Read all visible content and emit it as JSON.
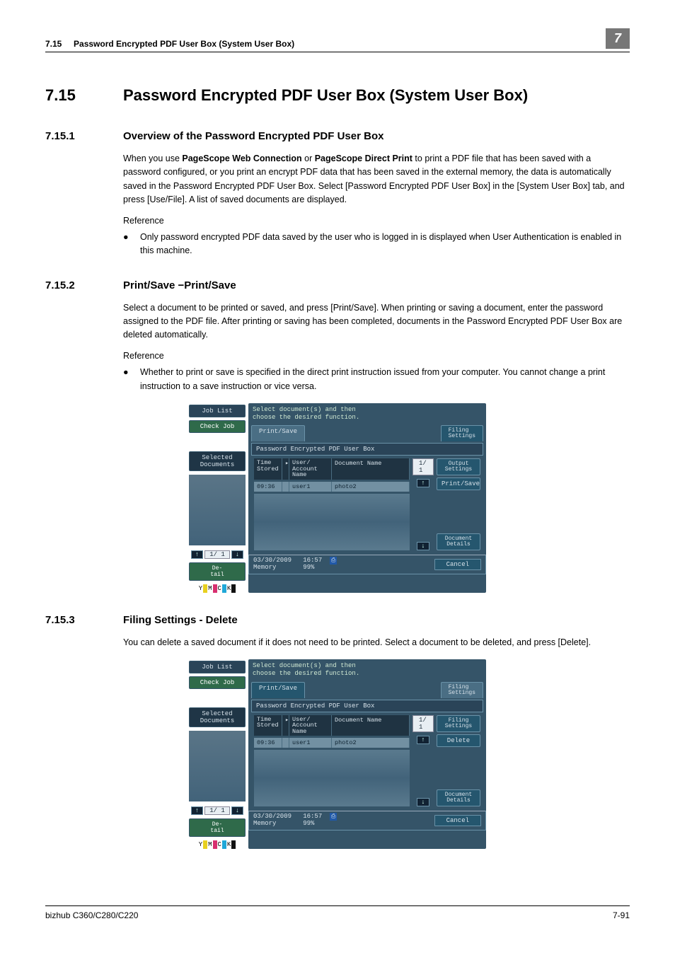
{
  "header": {
    "section_ref": "7.15",
    "section_title_short": "Password Encrypted PDF User Box (System User Box)",
    "chapter_badge": "7"
  },
  "title": {
    "num": "7.15",
    "text": "Password Encrypted PDF User Box (System User Box)"
  },
  "s1": {
    "num": "7.15.1",
    "heading": "Overview of the Password Encrypted PDF User Box",
    "para_pre": "When you use ",
    "bold1": "PageScope Web Connection",
    "para_mid": " or ",
    "bold2": "PageScope Direct Print",
    "para_post": " to print a PDF file that has been saved with a password configured, or you print an encrypt PDF data that has been saved in the external memory, the data is automatically saved in the Password Encrypted PDF User Box. Select [Password Encrypted PDF User Box] in the [System User Box] tab, and press [Use/File]. A list of saved documents are displayed.",
    "reference_label": "Reference",
    "ref_item": "Only password encrypted PDF data saved by the user who is logged in is displayed when User Authentication is enabled in this machine."
  },
  "s2": {
    "num": "7.15.2",
    "heading": "Print/Save −Print/Save",
    "para": "Select a document to be printed or saved, and press [Print/Save]. When printing or saving a document, enter the password assigned to the PDF file. After printing or saving has been completed, documents in the Password Encrypted PDF User Box are deleted automatically.",
    "reference_label": "Reference",
    "ref_item": "Whether to print or save is specified in the direct print instruction issued from your computer. You cannot change a print instruction to a save instruction or vice versa."
  },
  "s3": {
    "num": "7.15.3",
    "heading": "Filing Settings - Delete",
    "para": "You can delete a saved document if it does not need to be printed. Select a document to be deleted, and press [Delete]."
  },
  "screen": {
    "joblist": "Job List",
    "checkjob": "Check Job",
    "seldocs": "Selected Documents",
    "instr1": "Select document(s) and then",
    "instr2": "choose the desired function.",
    "tab_printsave": "Print/Save",
    "tab_filing": "Filing\nSettings",
    "panel_title": "Password Encrypted PDF User Box",
    "col_time": "Time\nStored",
    "col_sel": "▸",
    "col_user": "User/\nAccount Name",
    "col_doc": "Document Name",
    "row_time": "09:36",
    "row_user": "user1",
    "row_doc": "photo2",
    "paging": "1/  1",
    "output_settings": "Output\nSettings",
    "printsave_btn": "Print/Save",
    "filing_settings_btn": "Filing\nSettings",
    "delete_btn": "Delete",
    "doc_details": "Document\nDetails",
    "left_pg": "1/ 1",
    "detail_btn": "De-\ntail",
    "date": "03/30/2009",
    "time": "16:57",
    "mem_label": "Memory",
    "mem_val": "99%",
    "cancel": "Cancel",
    "toner": {
      "y": "Y",
      "m": "M",
      "c": "C",
      "k": "K"
    },
    "arrow_up": "↑",
    "arrow_down": "↓"
  },
  "footer": {
    "left": "bizhub C360/C280/C220",
    "right": "7-91"
  },
  "bullet": "●"
}
